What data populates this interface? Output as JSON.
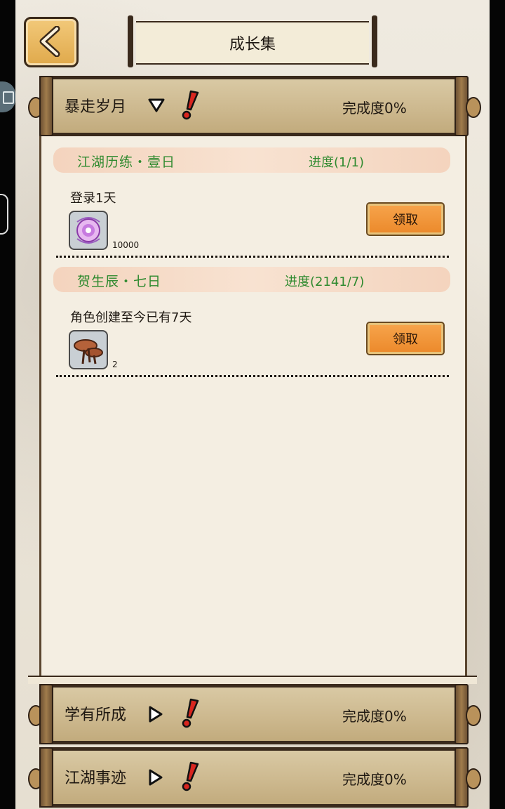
{
  "page": {
    "title": "成长集"
  },
  "back_button": {
    "icon": "chevron-left-icon"
  },
  "categories": [
    {
      "name": "暴走岁月",
      "completion": "完成度0%",
      "expanded": true
    },
    {
      "name": "学有所成",
      "completion": "完成度0%",
      "expanded": false
    },
    {
      "name": "江湖事迹",
      "completion": "完成度0%",
      "expanded": false
    }
  ],
  "tasks": [
    {
      "name": "江湖历练・壹日",
      "progress": "进度(1/1)",
      "description": "登录1天",
      "reward_icon": "orb-icon",
      "reward_qty": "10000",
      "claim_label": "领取"
    },
    {
      "name": "贺生辰・七日",
      "progress": "进度(2141/7)",
      "description": "角色创建至今已有7天",
      "reward_icon": "mushroom-icon",
      "reward_qty": "2",
      "claim_label": "领取"
    }
  ],
  "colors": {
    "task_title": "#2f8a2f",
    "claim_button": "#ec8a2c",
    "alert": "#d8261f"
  }
}
